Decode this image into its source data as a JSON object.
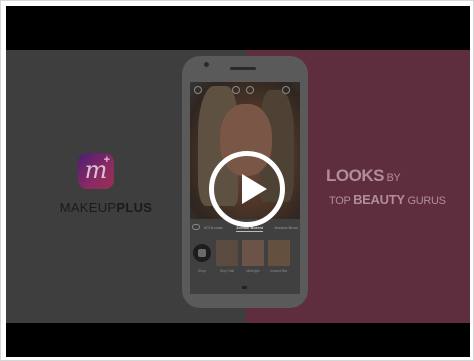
{
  "video": {
    "brand_name_regular": "MAKEUP",
    "brand_name_bold": "PLUS",
    "logo_letter": "m",
    "logo_plus": "+",
    "tagline_looks": "LOOKS",
    "tagline_by": " BY",
    "tagline_top": "TOP ",
    "tagline_beauty": "BEAUTY",
    "tagline_gurus": " GURUS",
    "colors": {
      "left_panel": "#3e3e3e",
      "right_panel": "#5e2d3e",
      "letterbox": "#000000",
      "play_button": "#ffffff"
    }
  },
  "phone_screen": {
    "tabs": [
      "#CHLooks",
      "Jordan Boreni",
      "Jessica Bruni"
    ],
    "active_tab": "Jordan Boreni",
    "shop_label": "Shop",
    "thumbnails": [
      "Stop Talk",
      "Midnight",
      "Instant Bar"
    ]
  },
  "icons": {
    "play": "play-icon",
    "logo": "makeupplus-logo-icon"
  }
}
